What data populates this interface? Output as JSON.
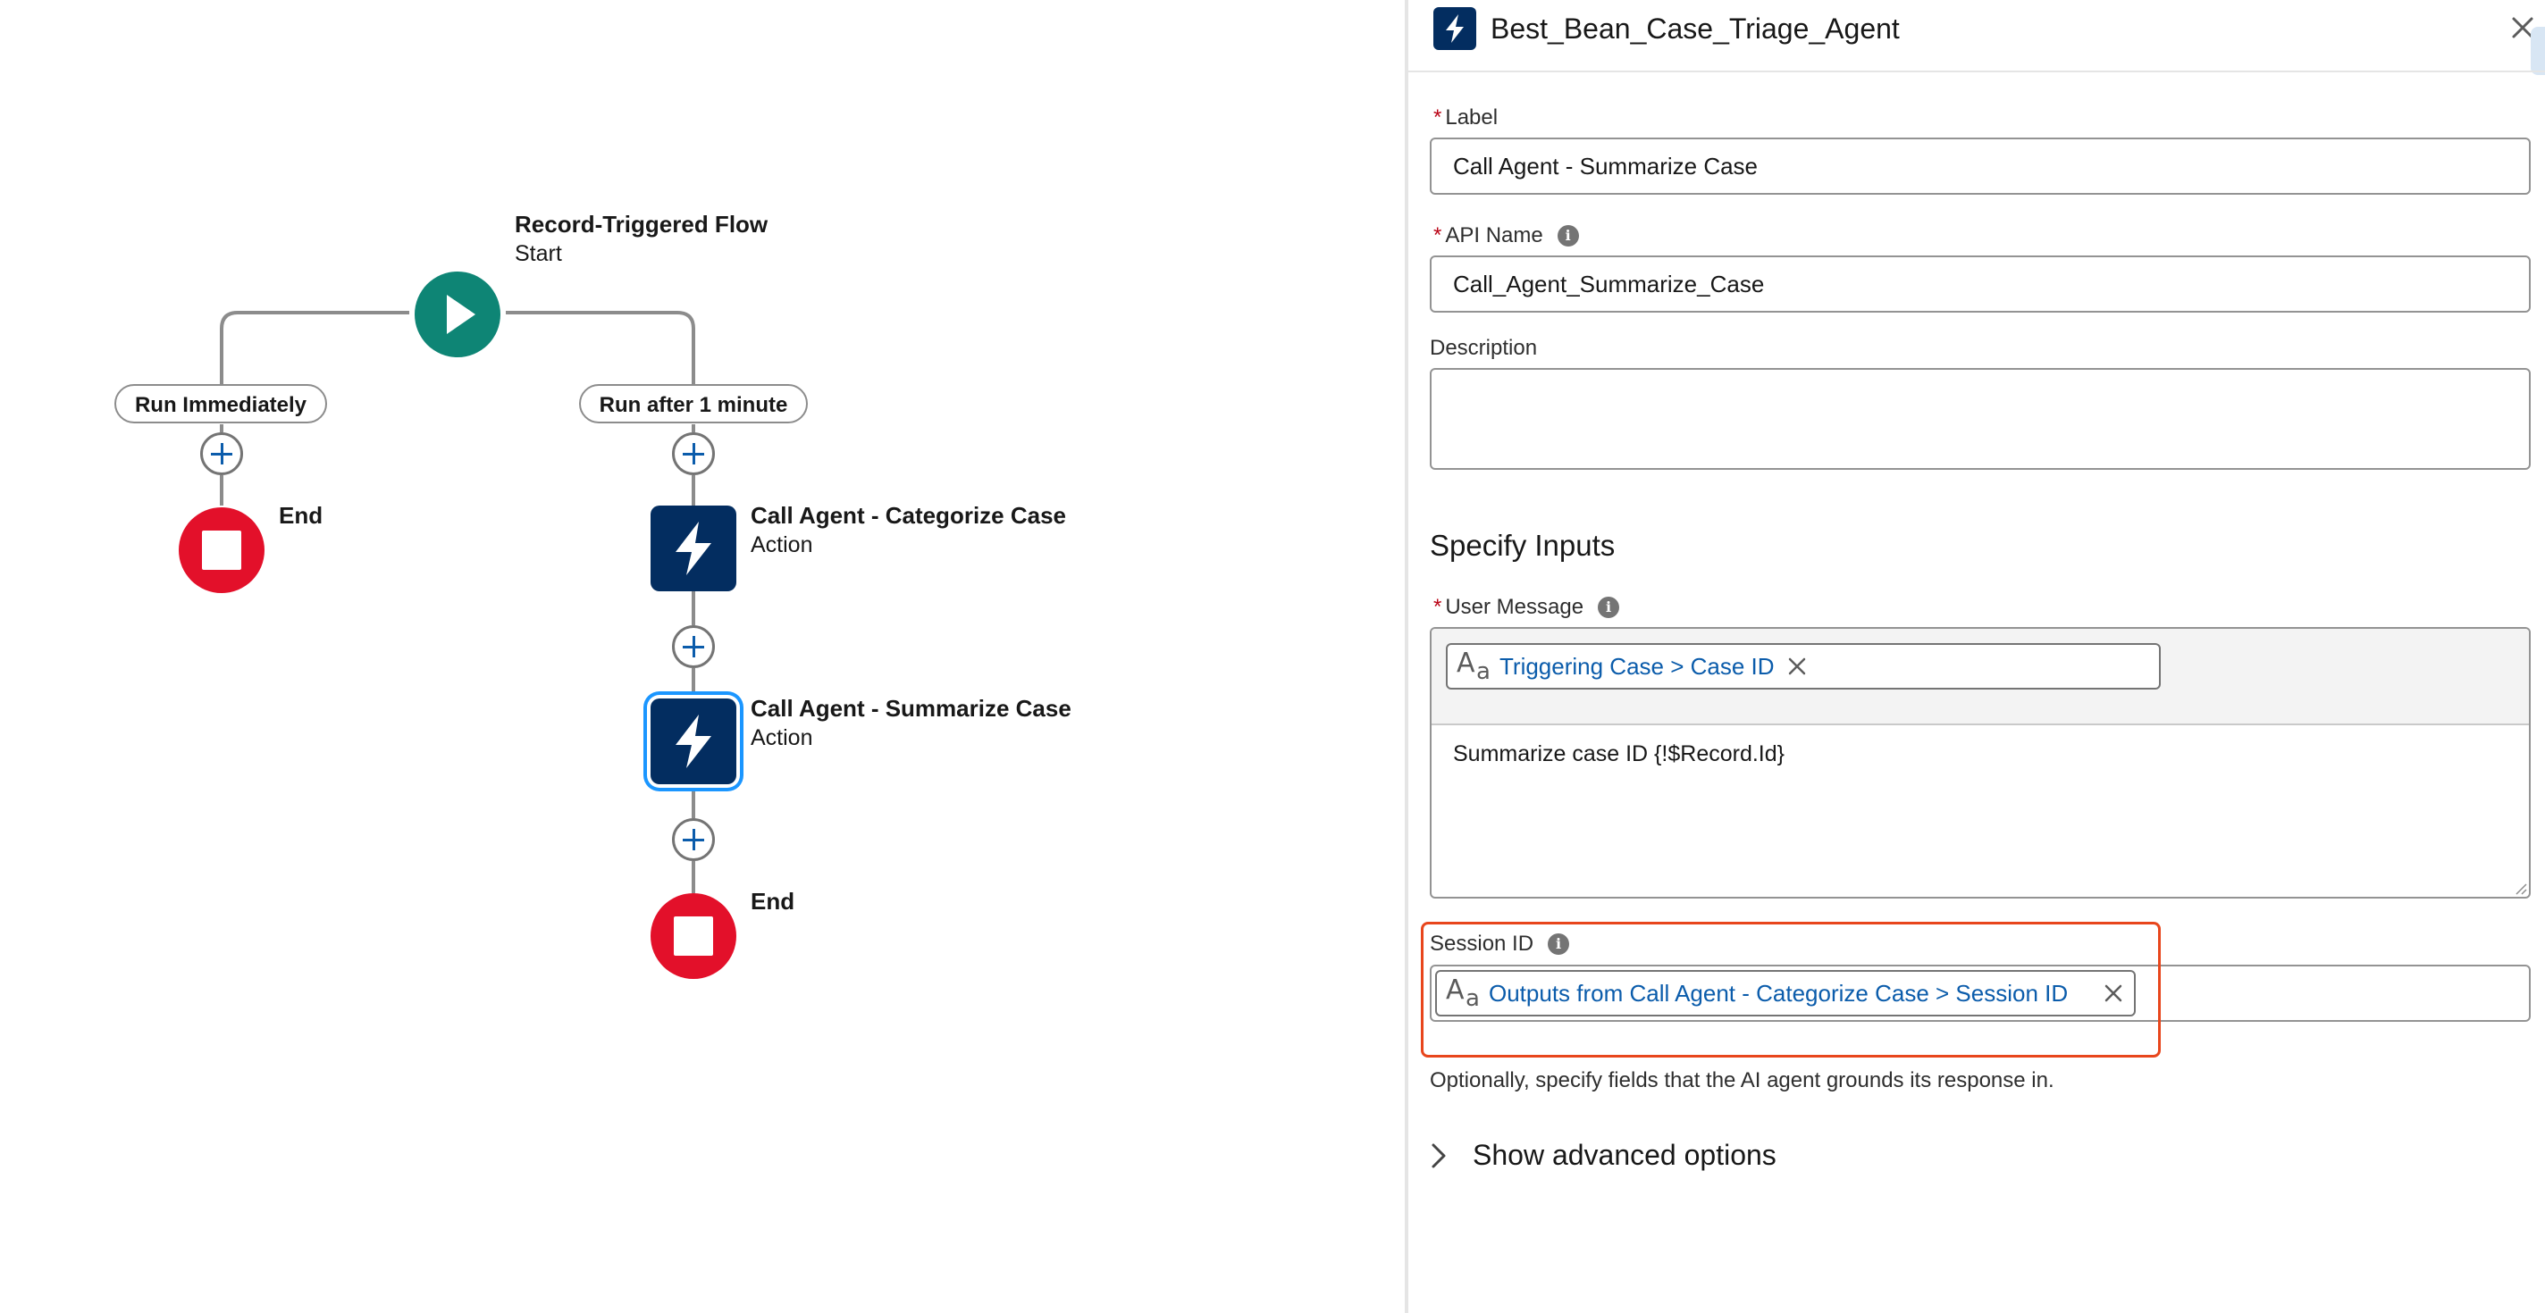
{
  "canvas": {
    "start_node": {
      "title": "Record-Triggered Flow",
      "subtitle": "Start",
      "icon": "play-icon"
    },
    "paths": [
      {
        "label": "Run Immediately"
      },
      {
        "label": "Run after 1 minute"
      }
    ],
    "left_end": {
      "title": "End"
    },
    "actions": [
      {
        "title": "Call Agent - Categorize Case",
        "subtitle": "Action",
        "icon": "lightning-bolt-icon"
      },
      {
        "title": "Call Agent - Summarize Case",
        "subtitle": "Action",
        "icon": "lightning-bolt-icon",
        "selected": true
      }
    ],
    "right_end": {
      "title": "End"
    }
  },
  "panel": {
    "title": "Best_Bean_Case_Triage_Agent",
    "label": {
      "caption": "Label",
      "required": "*",
      "value": "Call Agent - Summarize Case"
    },
    "api_name": {
      "caption": "API Name",
      "required": "*",
      "value": "Call_Agent_Summarize_Case"
    },
    "description": {
      "caption": "Description",
      "value": ""
    },
    "section_title": "Specify Inputs",
    "user_message": {
      "caption": "User Message",
      "required": "*",
      "token": "Triggering Case > Case ID",
      "message": "Summarize case ID {!$Record.Id}"
    },
    "session_id": {
      "caption": "Session ID",
      "token": "Outputs from Call Agent - Categorize Case > Session ID"
    },
    "help_text": "Optionally, specify fields that the AI agent grounds its response in.",
    "advanced_label": "Show advanced options"
  },
  "colors": {
    "start": "#0e8575",
    "end": "#e3102a",
    "action": "#032d60",
    "selection": "#1b96ff",
    "link": "#0b5cab",
    "highlight": "#e8461c"
  }
}
